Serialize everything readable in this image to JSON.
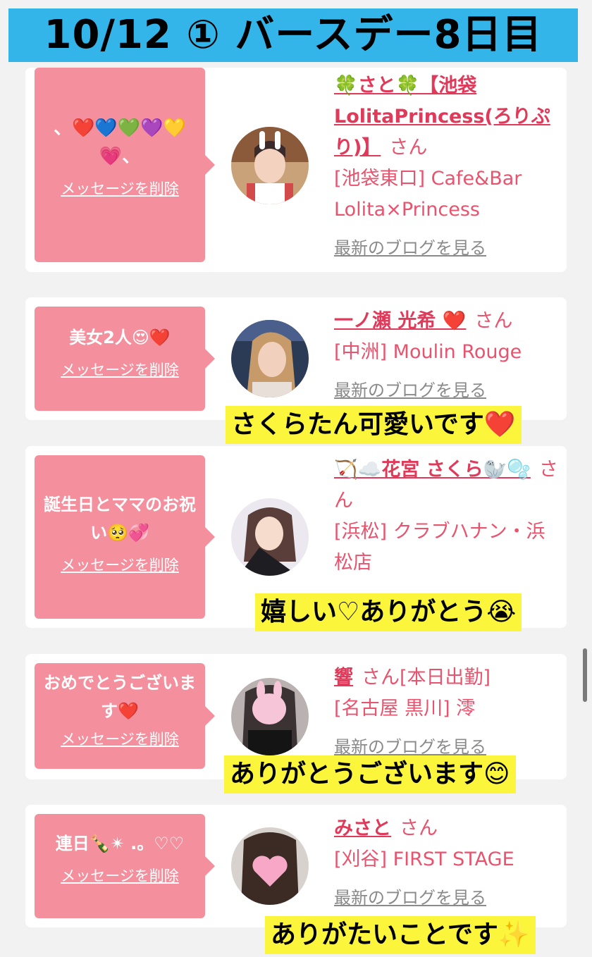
{
  "title": "10/12 ① バースデー8日目",
  "cards": [
    {
      "message": "、❤️💙💚💜💛💗、",
      "delete_label": "メッセージを削除",
      "name": "🍀さと🍀【池袋LolitaPrincess(ろりぷり)】",
      "honorific": "さん",
      "shop": "[池袋東口] Cafe&Bar Lolita×Princess",
      "blog_label": "最新のブログを見る"
    },
    {
      "message": "美女2人😍❤️",
      "delete_label": "メッセージを削除",
      "name": "一ノ瀬 光希 ❤️",
      "honorific": "さん",
      "shop": "[中洲] Moulin Rouge",
      "blog_label": "最新のブログを見る",
      "caption": "さくらたん可愛いです❤️"
    },
    {
      "message": "誕生日とママのお祝い🥺💞",
      "delete_label": "メッセージを削除",
      "name": "🏹☁️花宮 さくら🦭🫧",
      "honorific": "さん",
      "shop": "[浜松] クラブハナン・浜松店",
      "caption": "嬉しい♡ありがとう😭"
    },
    {
      "message": "おめでとうございます❤️",
      "delete_label": "メッセージを削除",
      "name": "響",
      "honorific": "さん[本日出勤]",
      "shop": "[名古屋 黒川] 澪",
      "blog_label": "最新のブログを見る",
      "caption": "ありがとうございます😊"
    },
    {
      "message": "連日🍾✴︎ .。♡♡",
      "delete_label": "メッセージを削除",
      "name": "みさと",
      "honorific": "さん",
      "shop": "[刈谷] FIRST STAGE",
      "blog_label": "最新のブログを見る",
      "caption": "ありがたいことです✨"
    }
  ]
}
